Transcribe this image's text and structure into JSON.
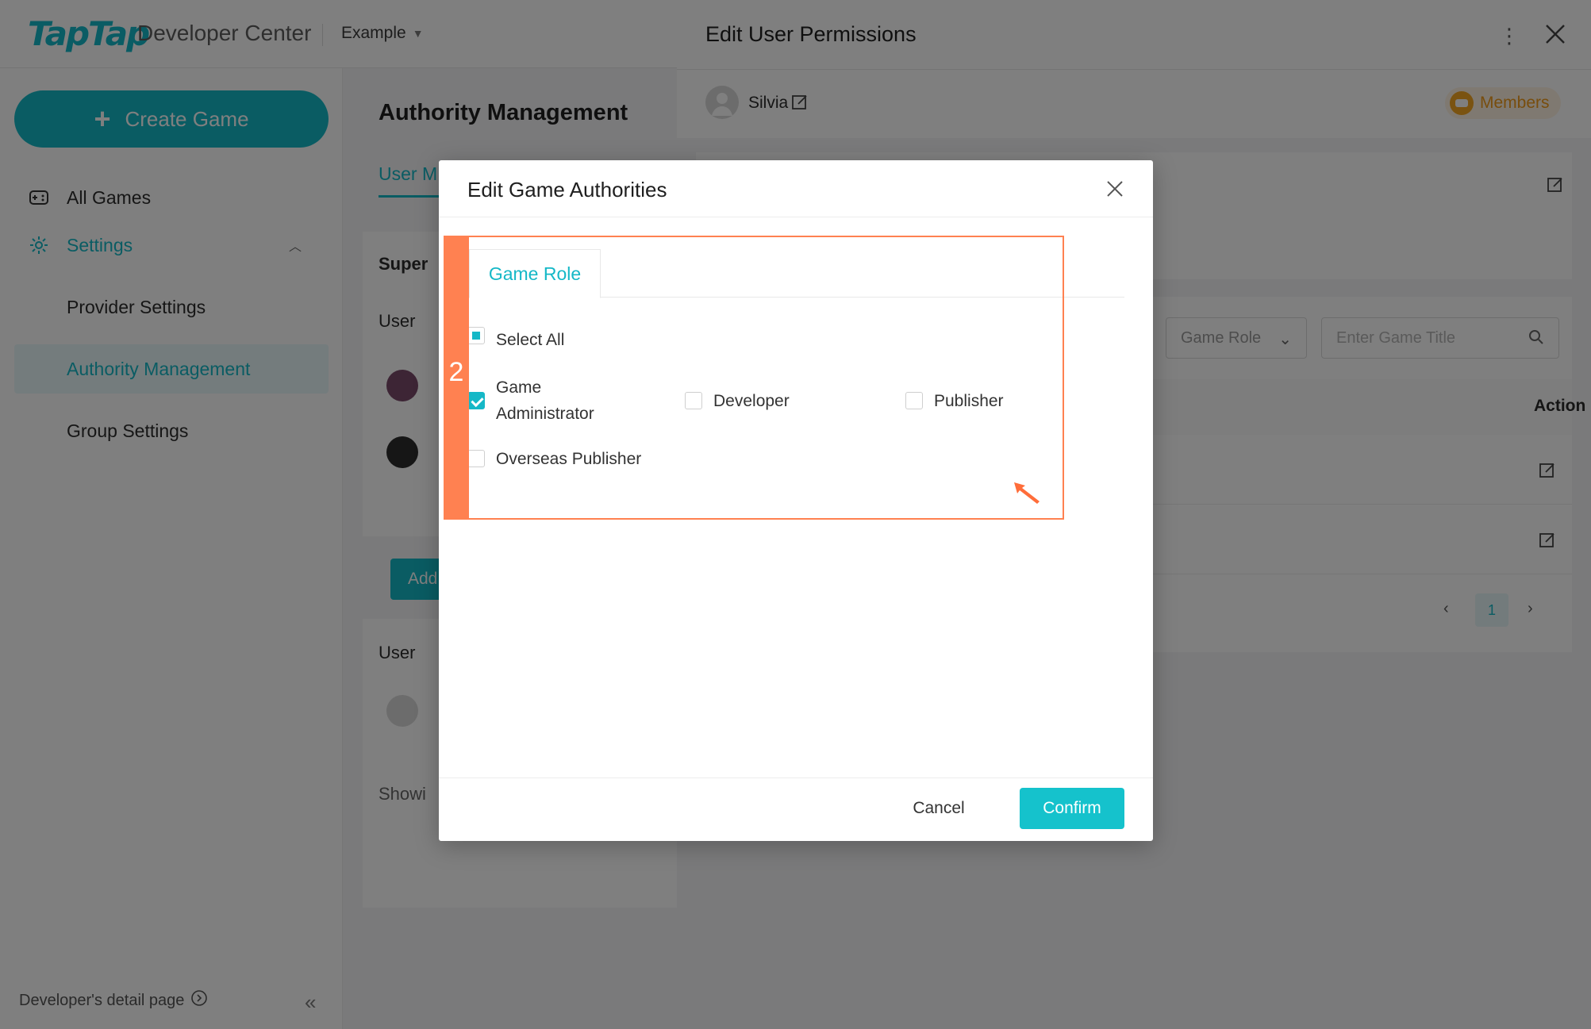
{
  "app": {
    "logo": "TapTap",
    "name": "Developer Center",
    "project": "Example"
  },
  "sidebar": {
    "create_button": "Create Game",
    "items": [
      {
        "label": "All Games",
        "icon": "gamepad-icon"
      },
      {
        "label": "Settings",
        "icon": "gear-icon"
      },
      {
        "label": "Provider Settings"
      },
      {
        "label": "Authority Management"
      },
      {
        "label": "Group Settings"
      }
    ],
    "footer": "Developer's detail page",
    "footer_icon": "info-circle-icon",
    "collapse_icon": "double-chevron-left-icon"
  },
  "content": {
    "title": "Authority Management",
    "tab_user": "User M",
    "section_super": "Super",
    "column_user": "User",
    "add_button": "Add",
    "column_user_2": "User",
    "showing": "Showi"
  },
  "drawer": {
    "title": "Edit User Permissions",
    "user_name": "Silvia",
    "members_badge": "Members",
    "filter_role": "Game Role",
    "search_placeholder": "Enter Game Title",
    "column_action": "Action",
    "current_page": "1"
  },
  "modal": {
    "title": "Edit Game Authorities",
    "tab": "Game Role",
    "select_all": "Select All",
    "roles": [
      {
        "label": "Game\nAdministrator",
        "checked": true
      },
      {
        "label": "Developer",
        "checked": false
      },
      {
        "label": "Publisher",
        "checked": false
      },
      {
        "label": "Overseas Publisher",
        "checked": false
      }
    ],
    "cancel": "Cancel",
    "confirm": "Confirm"
  },
  "annotation": {
    "step": "2"
  },
  "colors": {
    "accent": "#15b8c7",
    "annotation": "#ff8151",
    "badge": "#f5a623"
  }
}
